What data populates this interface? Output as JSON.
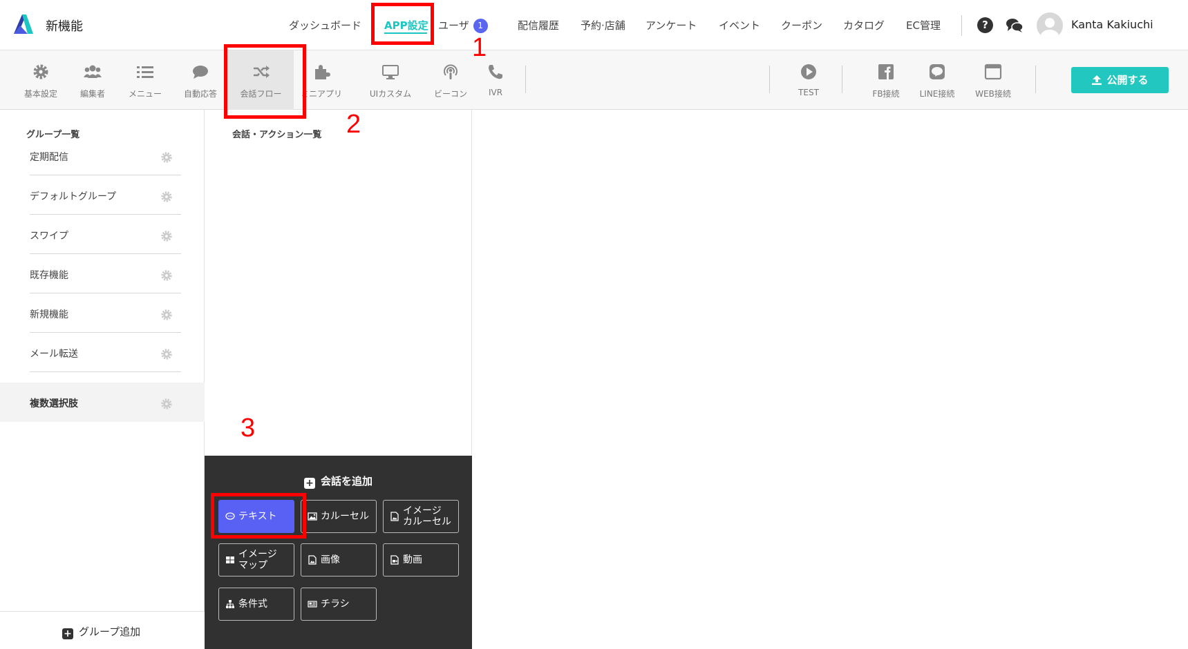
{
  "app": {
    "title": "新機能"
  },
  "nav": {
    "items": [
      "ダッシュボード",
      "APP設定",
      "ユーザ",
      "配信履歴",
      "予約·店舗",
      "アンケート",
      "イベント",
      "クーポン",
      "カタログ",
      "EC管理"
    ],
    "user_badge": "1",
    "user_name": "Kanta Kakiuchi",
    "help_glyph": "?"
  },
  "toolbar": {
    "tools": [
      "基本設定",
      "編集者",
      "メニュー",
      "自動応答",
      "会話フロー",
      "ミニアプリ",
      "UIカスタム",
      "ビーコン",
      "IVR"
    ],
    "right_tools": [
      "TEST",
      "FB接続",
      "LINE接続",
      "WEB接続"
    ],
    "publish_label": "公開する"
  },
  "sidebar": {
    "heading": "グループ一覧",
    "groups": [
      "定期配信",
      "デフォルトグループ",
      "スワイプ",
      "既存機能",
      "新規機能",
      "メール転送",
      "複数選択肢"
    ],
    "add_group_label": "グループ追加"
  },
  "middle": {
    "heading": "会話・アクション一覧",
    "add_panel": {
      "title": "会話を追加",
      "buttons": [
        {
          "line1": "テキスト",
          "line2": "",
          "icon": "speech-bubble-icon"
        },
        {
          "line1": "カルーセル",
          "line2": "",
          "icon": "image-icon"
        },
        {
          "line1": "イメージ",
          "line2": "カルーセル",
          "icon": "file-image-icon"
        },
        {
          "line1": "イメージ",
          "line2": "マップ",
          "icon": "grid-icon"
        },
        {
          "line1": "画像",
          "line2": "",
          "icon": "file-image-icon"
        },
        {
          "line1": "動画",
          "line2": "",
          "icon": "file-video-icon"
        },
        {
          "line1": "条件式",
          "line2": "",
          "icon": "sitemap-icon"
        },
        {
          "line1": "チラシ",
          "line2": "",
          "icon": "newspaper-icon"
        }
      ]
    }
  },
  "annotations": {
    "n1": "1",
    "n2": "2",
    "n3": "3"
  },
  "colors": {
    "accent": "#1cc6c2",
    "publish": "#22c8c0",
    "primary_button": "#5960f4",
    "annotation": "#ff0000",
    "panel_bg": "#313131"
  }
}
